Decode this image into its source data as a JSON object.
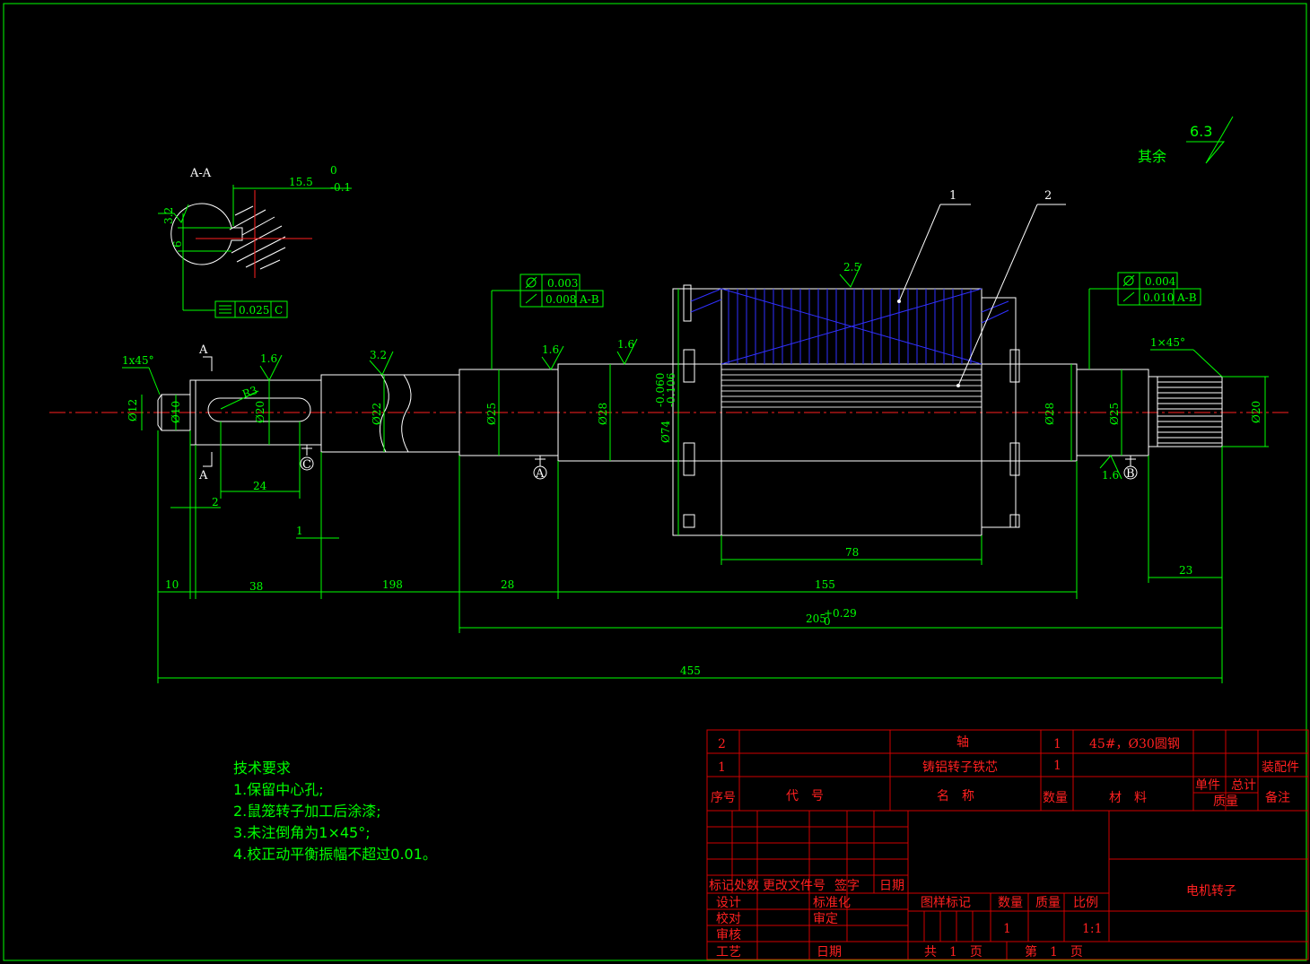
{
  "surface_roughness_rest": {
    "label": "其余",
    "value": "6.3"
  },
  "section_view": {
    "title": "A-A",
    "width_dim": "15.5",
    "tol_upper": "0",
    "tol_lower": "-0.1",
    "roughness": "3.2",
    "key_dim": "6",
    "symmetry_tol": "0.025",
    "datum": "C"
  },
  "part_balloons": [
    "1",
    "2"
  ],
  "geo_tol_left": {
    "runout": "0.003",
    "runout2": "0.008",
    "datum": "A-B"
  },
  "geo_tol_right": {
    "runout": "0.004",
    "runout2": "0.010",
    "datum": "A-B"
  },
  "diameters": {
    "d12": "Ø12",
    "d10": "Ø10",
    "d20_key": "Ø20",
    "d22": "Ø22",
    "d25_left": "Ø25",
    "d28_left": "Ø28",
    "d74": "Ø74",
    "d74_tol_u": "-0.060",
    "d74_tol_l": "-0.106",
    "d28_right": "Ø28",
    "d25_right": "Ø25",
    "d20_right": "Ø20"
  },
  "roughness_marks": [
    "1.6",
    "3.2",
    "1.6",
    "1.6",
    "2.5",
    "1.6"
  ],
  "chamfer_left": "1x45°",
  "chamfer_right": "1×45°",
  "key_radius": "R3",
  "section_marks": [
    "A",
    "A"
  ],
  "datum_marks": [
    "C",
    "A",
    "B"
  ],
  "lengths": {
    "l10": "10",
    "l38": "38",
    "l198": "198",
    "l28": "28",
    "l155": "155",
    "l205": "205",
    "l205_tol_u": "+0.29",
    "l205_tol_l": "0",
    "l455": "455",
    "l24": "24",
    "l2": "2",
    "l1": "1",
    "l78": "78",
    "l23": "23"
  },
  "tech_requirements": {
    "title": "技术要求",
    "items": [
      "1.保留中心孔;",
      "2.鼠笼转子加工后涂漆;",
      "3.未注倒角为1×45°;",
      "4.校正动平衡振幅不超过0.01。"
    ]
  },
  "bom": {
    "rows": [
      {
        "no": "2",
        "code": "",
        "name": "轴",
        "qty": "1",
        "material": "45#，Ø30圆钢",
        "unit_mass": "",
        "total_mass": "",
        "note": ""
      },
      {
        "no": "1",
        "code": "",
        "name": "铸铝转子铁芯",
        "qty": "1",
        "material": "",
        "unit_mass": "",
        "total_mass": "",
        "note": "装配件"
      }
    ],
    "header": {
      "no": "序号",
      "code": "代　号",
      "name": "名　称",
      "qty": "数量",
      "material": "材　料",
      "unit": "单件",
      "total": "总计",
      "mass": "质量",
      "note": "备注"
    }
  },
  "title_block": {
    "drawing_name": "电机转子",
    "rev_header": [
      "标记",
      "处数",
      "更改文件号",
      "签字",
      "日期"
    ],
    "design": "设计",
    "standard": "标准化",
    "check": "校对",
    "review": "审定",
    "audit": "审核",
    "process": "工艺",
    "date": "日期",
    "drawing_mark": "图样标记",
    "qty_label": "数量",
    "mass_label": "质量",
    "scale_label": "比例",
    "qty_value": "1",
    "scale_value": "1:1",
    "sheets_total": "共　1　页",
    "sheet_no": "第　1　页"
  }
}
